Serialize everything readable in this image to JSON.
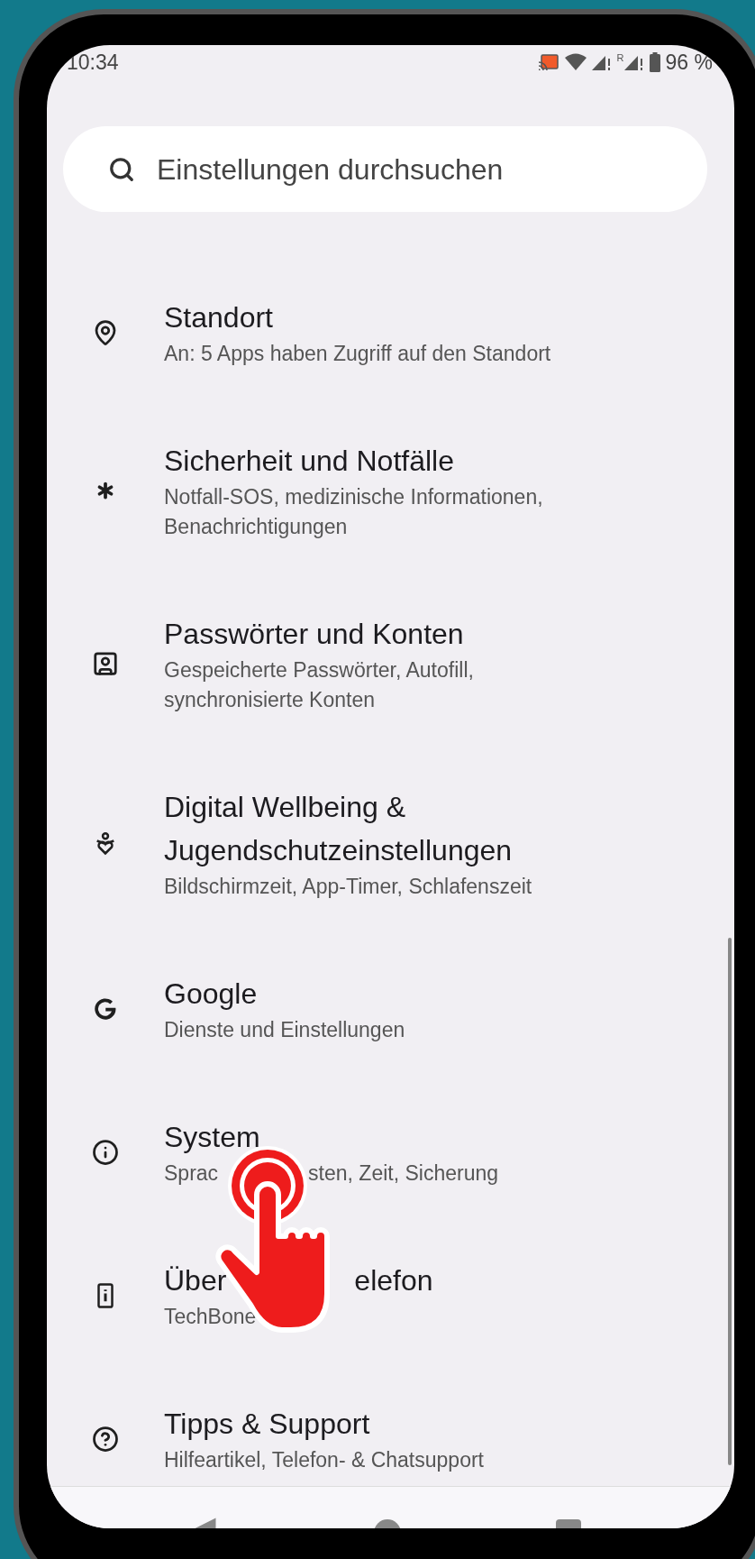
{
  "status_bar": {
    "time": "10:34",
    "roaming": "R",
    "battery": "96 %"
  },
  "search": {
    "placeholder": "Einstellungen durchsuchen"
  },
  "items": [
    {
      "title": [
        [
          "Standort"
        ]
      ],
      "subtitle": [
        [
          "An: 5 Apps haben Zugriff auf den Standort"
        ]
      ]
    },
    {
      "title": [
        [
          "Sicherheit und Notfälle"
        ]
      ],
      "subtitle": [
        [
          "Notfall-SOS, medizinische Informationen,"
        ],
        [
          "Benachrichtigungen"
        ]
      ]
    },
    {
      "title": [
        [
          "Passwörter und Konten"
        ]
      ],
      "subtitle": [
        [
          "Gespeicherte Passwörter, Autofill,"
        ],
        [
          "synchronisierte Konten"
        ]
      ]
    },
    {
      "title": [
        [
          "Digital Wellbeing &"
        ],
        [
          "Jugendschutzeinstellungen"
        ]
      ],
      "subtitle": [
        [
          "Bildschirmzeit, App-Timer, Schlafenszeit"
        ]
      ]
    },
    {
      "title": [
        [
          "Google"
        ]
      ],
      "subtitle": [
        [
          "Dienste und Einstellungen"
        ]
      ]
    },
    {
      "title": [
        [
          "System"
        ]
      ],
      "subtitle": [
        [
          "Sprac",
          "sten, Zeit, Sicherung"
        ]
      ]
    },
    {
      "title": [
        [
          "Über",
          "elefon"
        ]
      ],
      "subtitle": [
        [
          "TechBone"
        ]
      ]
    },
    {
      "title": [
        [
          "Tipps & Support"
        ]
      ],
      "subtitle": [
        [
          "Hilfeartikel, Telefon- & Chatsupport"
        ]
      ]
    }
  ]
}
